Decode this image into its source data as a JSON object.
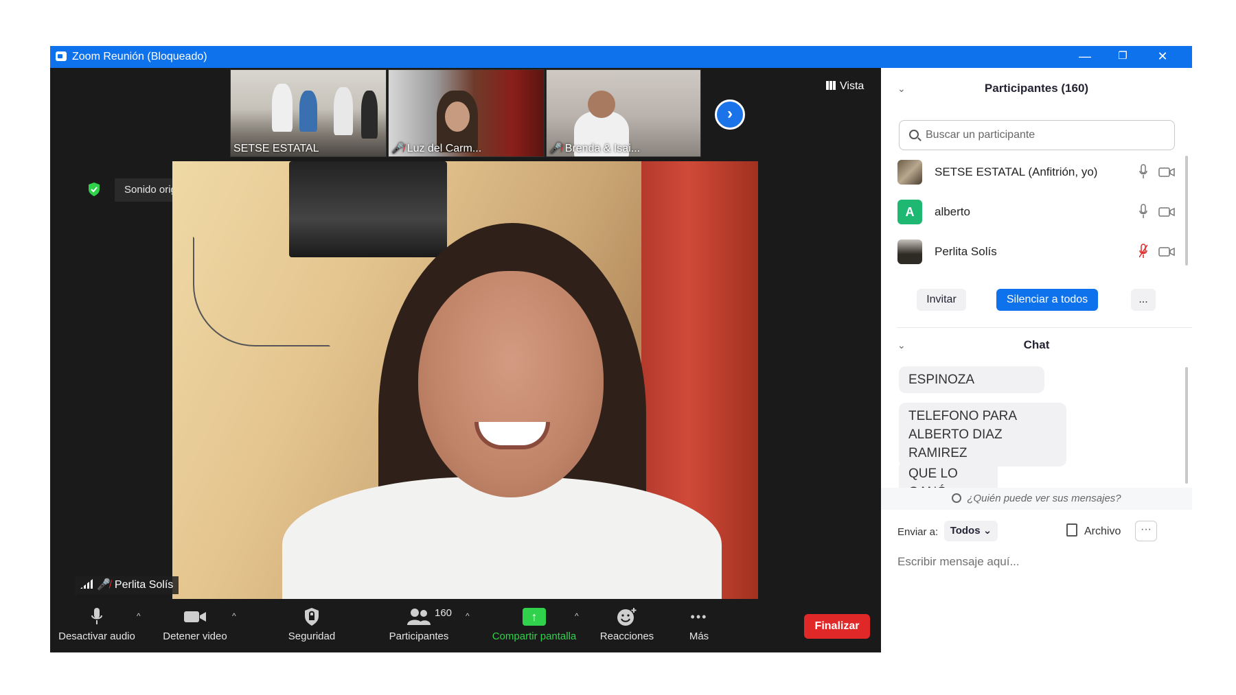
{
  "window": {
    "title": "Zoom Reunión (Bloqueado)",
    "minimize": "—",
    "restore": "❐",
    "close": "✕"
  },
  "gallery": {
    "thumbnails": [
      {
        "name": "SETSE ESTATAL",
        "muted": false
      },
      {
        "name": "Luz del Carm...",
        "muted": true
      },
      {
        "name": "Brenda & Isai...",
        "muted": true
      }
    ],
    "next_glyph": "›",
    "view_label": "Vista"
  },
  "audio": {
    "original_sound": "Sonido original: desactivado",
    "caret": "▾"
  },
  "speaker": {
    "name": "Perlita Solís",
    "muted": true
  },
  "toolbar": {
    "mute_label": "Desactivar audio",
    "video_label": "Detener video",
    "security_label": "Seguridad",
    "participants_label": "Participantes",
    "participants_count": "160",
    "share_label": "Compartir pantalla",
    "reactions_label": "Reacciones",
    "more_label": "Más",
    "end_label": "Finalizar",
    "caret": "^",
    "more_glyph": "•••",
    "share_glyph": "↑",
    "colors": {
      "share": "#2fd24a",
      "end": "#e02828"
    }
  },
  "participants_panel": {
    "title": "Participantes (160)",
    "search_placeholder": "Buscar un participante",
    "chevron": "⌄",
    "list": [
      {
        "name": "SETSE ESTATAL (Anfitrión, yo)",
        "avatar": "",
        "muted": false
      },
      {
        "name": "alberto",
        "avatar": "A",
        "muted": false
      },
      {
        "name": "Perlita Solís",
        "avatar": "",
        "muted": true
      }
    ],
    "invite_label": "Invitar",
    "mute_all_label": "Silenciar a todos",
    "more_label": "..."
  },
  "chat": {
    "title": "Chat",
    "messages": [
      "ESPINOZA",
      "TELEFONO PARA ALBERTO DIAZ RAMIREZ",
      "QUE LO GANÓ"
    ],
    "who_can_see": "¿Quién puede ver sus mensajes?",
    "send_to_label": "Enviar a:",
    "send_to_value": "Todos ⌄",
    "file_label": "Archivo",
    "more_label": "···",
    "input_placeholder": "Escribir mensaje aquí..."
  },
  "colors": {
    "accent": "#0e72ed",
    "muted_red": "#e02828",
    "avatar_green": "#1fb873",
    "security_green": "#2fd24a"
  }
}
